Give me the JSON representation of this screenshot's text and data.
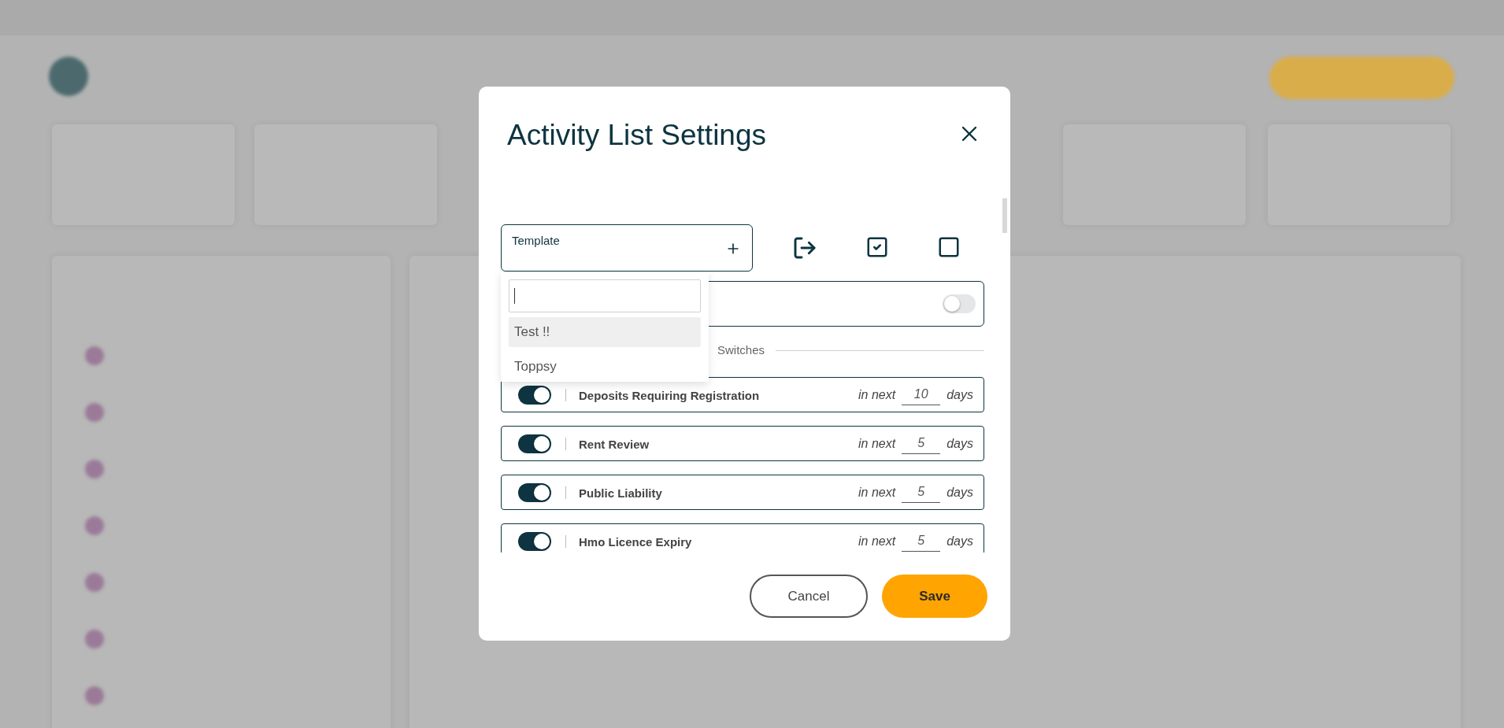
{
  "dialog": {
    "title": "Activity List Settings",
    "template_field": {
      "label": "Template"
    },
    "template_menu": {
      "options": [
        {
          "label": "Test !!",
          "selected": true
        },
        {
          "label": "Toppsy",
          "selected": false
        }
      ]
    },
    "master_switch": {
      "on": false
    },
    "section_label": "Switches",
    "switches": [
      {
        "label": "Deposits Requiring Registration",
        "on": true,
        "prefix": "in next",
        "days": "10",
        "unit": "days"
      },
      {
        "label": "Rent Review",
        "on": true,
        "prefix": "in next",
        "days": "5",
        "unit": "days"
      },
      {
        "label": "Public Liability",
        "on": true,
        "prefix": "in next",
        "days": "5",
        "unit": "days"
      },
      {
        "label": "Hmo Licence Expiry",
        "on": true,
        "prefix": "in next",
        "days": "5",
        "unit": "days"
      }
    ],
    "buttons": {
      "cancel": "Cancel",
      "save": "Save"
    }
  }
}
